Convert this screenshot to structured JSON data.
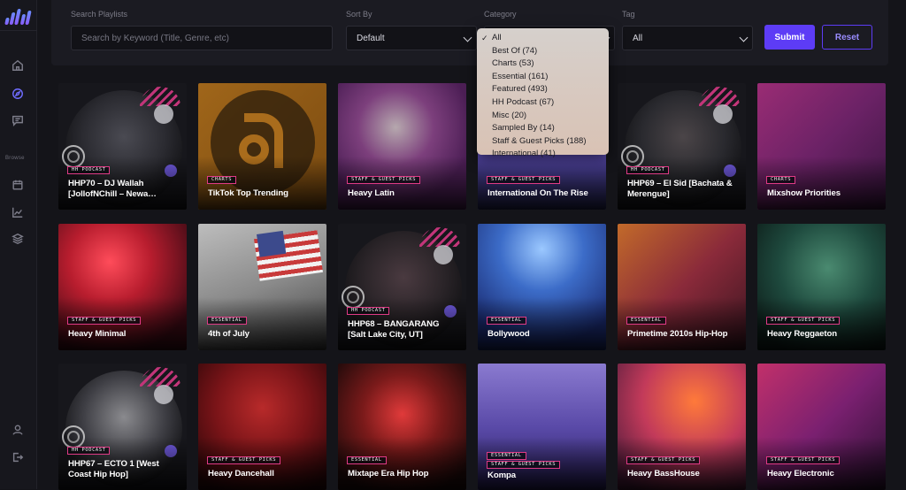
{
  "sidebar": {
    "section_label": "Browse",
    "icons": [
      "home-icon",
      "compass-icon",
      "chat-icon",
      "calendar-icon",
      "chart-icon",
      "layers-icon",
      "user-icon",
      "logout-icon"
    ]
  },
  "filters": {
    "search_label": "Search Playlists",
    "search_placeholder": "Search by Keyword (Title, Genre, etc)",
    "sort_label": "Sort By",
    "sort_value": "Default",
    "category_label": "Category",
    "tag_label": "Tag",
    "tag_value": "All",
    "submit_label": "Submit",
    "reset_label": "Reset"
  },
  "category_dropdown": {
    "selected": "All",
    "options": [
      "All",
      "Best Of (74)",
      "Charts (53)",
      "Essential (161)",
      "Featured (493)",
      "HH Podcast (67)",
      "Misc (20)",
      "Sampled By (14)",
      "Staff & Guest Picks (188)",
      "International (41)"
    ]
  },
  "colors": {
    "accent": "#5d3cf6",
    "tag_border": "#e03a86",
    "background": "#141419"
  },
  "cards": [
    {
      "tag": "HH PODCAST",
      "title": "HHP70 – DJ Wallah [JollofNChill – Newa…"
    },
    {
      "tag": "CHARTS",
      "title": "TikTok Top Trending"
    },
    {
      "tag": "STAFF & GUEST PICKS",
      "title": "Heavy Latin"
    },
    {
      "tag": "STAFF & GUEST PICKS",
      "title": "International On The Rise"
    },
    {
      "tag": "HH PODCAST",
      "title": "HHP69 – El Sid [Bachata & Merengue]"
    },
    {
      "tag": "CHARTS",
      "title": "Mixshow Priorities"
    },
    {
      "tag": "STAFF & GUEST PICKS",
      "title": "Heavy Minimal"
    },
    {
      "tag": "ESSENTIAL",
      "title": "4th of July"
    },
    {
      "tag": "HH PODCAST",
      "title": "HHP68 – BANGARANG [Salt Lake City, UT]"
    },
    {
      "tag": "ESSENTIAL",
      "title": "Bollywood"
    },
    {
      "tag": "ESSENTIAL",
      "title": "Primetime 2010s Hip-Hop"
    },
    {
      "tag": "STAFF & GUEST PICKS",
      "title": "Heavy Reggaeton"
    },
    {
      "tag": "HH PODCAST",
      "title": "HHP67 – ECTO 1 [West Coast Hip Hop]"
    },
    {
      "tag": "STAFF & GUEST PICKS",
      "title": "Heavy Dancehall"
    },
    {
      "tag": "ESSENTIAL",
      "title": "Mixtape Era Hip Hop"
    },
    {
      "tag": "ESSENTIAL",
      "tag2": "STAFF & GUEST PICKS",
      "title": "Kompa"
    },
    {
      "tag": "STAFF & GUEST PICKS",
      "title": "Heavy BassHouse"
    },
    {
      "tag": "STAFF & GUEST PICKS",
      "title": "Heavy Electronic"
    }
  ]
}
